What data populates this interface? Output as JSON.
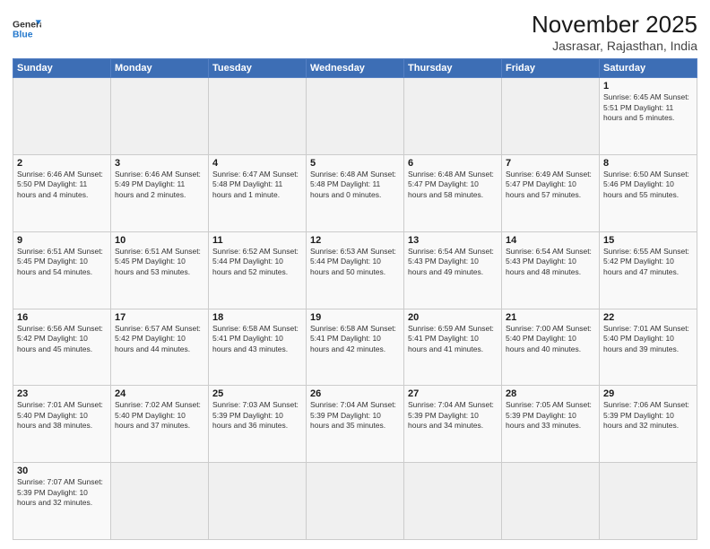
{
  "header": {
    "logo_general": "General",
    "logo_blue": "Blue",
    "title": "November 2025",
    "subtitle": "Jasrasar, Rajasthan, India"
  },
  "weekdays": [
    "Sunday",
    "Monday",
    "Tuesday",
    "Wednesday",
    "Thursday",
    "Friday",
    "Saturday"
  ],
  "weeks": [
    [
      {
        "day": "",
        "info": ""
      },
      {
        "day": "",
        "info": ""
      },
      {
        "day": "",
        "info": ""
      },
      {
        "day": "",
        "info": ""
      },
      {
        "day": "",
        "info": ""
      },
      {
        "day": "",
        "info": ""
      },
      {
        "day": "1",
        "info": "Sunrise: 6:45 AM\nSunset: 5:51 PM\nDaylight: 11 hours\nand 5 minutes."
      }
    ],
    [
      {
        "day": "2",
        "info": "Sunrise: 6:46 AM\nSunset: 5:50 PM\nDaylight: 11 hours\nand 4 minutes."
      },
      {
        "day": "3",
        "info": "Sunrise: 6:46 AM\nSunset: 5:49 PM\nDaylight: 11 hours\nand 2 minutes."
      },
      {
        "day": "4",
        "info": "Sunrise: 6:47 AM\nSunset: 5:48 PM\nDaylight: 11 hours\nand 1 minute."
      },
      {
        "day": "5",
        "info": "Sunrise: 6:48 AM\nSunset: 5:48 PM\nDaylight: 11 hours\nand 0 minutes."
      },
      {
        "day": "6",
        "info": "Sunrise: 6:48 AM\nSunset: 5:47 PM\nDaylight: 10 hours\nand 58 minutes."
      },
      {
        "day": "7",
        "info": "Sunrise: 6:49 AM\nSunset: 5:47 PM\nDaylight: 10 hours\nand 57 minutes."
      },
      {
        "day": "8",
        "info": "Sunrise: 6:50 AM\nSunset: 5:46 PM\nDaylight: 10 hours\nand 55 minutes."
      }
    ],
    [
      {
        "day": "9",
        "info": "Sunrise: 6:51 AM\nSunset: 5:45 PM\nDaylight: 10 hours\nand 54 minutes."
      },
      {
        "day": "10",
        "info": "Sunrise: 6:51 AM\nSunset: 5:45 PM\nDaylight: 10 hours\nand 53 minutes."
      },
      {
        "day": "11",
        "info": "Sunrise: 6:52 AM\nSunset: 5:44 PM\nDaylight: 10 hours\nand 52 minutes."
      },
      {
        "day": "12",
        "info": "Sunrise: 6:53 AM\nSunset: 5:44 PM\nDaylight: 10 hours\nand 50 minutes."
      },
      {
        "day": "13",
        "info": "Sunrise: 6:54 AM\nSunset: 5:43 PM\nDaylight: 10 hours\nand 49 minutes."
      },
      {
        "day": "14",
        "info": "Sunrise: 6:54 AM\nSunset: 5:43 PM\nDaylight: 10 hours\nand 48 minutes."
      },
      {
        "day": "15",
        "info": "Sunrise: 6:55 AM\nSunset: 5:42 PM\nDaylight: 10 hours\nand 47 minutes."
      }
    ],
    [
      {
        "day": "16",
        "info": "Sunrise: 6:56 AM\nSunset: 5:42 PM\nDaylight: 10 hours\nand 45 minutes."
      },
      {
        "day": "17",
        "info": "Sunrise: 6:57 AM\nSunset: 5:42 PM\nDaylight: 10 hours\nand 44 minutes."
      },
      {
        "day": "18",
        "info": "Sunrise: 6:58 AM\nSunset: 5:41 PM\nDaylight: 10 hours\nand 43 minutes."
      },
      {
        "day": "19",
        "info": "Sunrise: 6:58 AM\nSunset: 5:41 PM\nDaylight: 10 hours\nand 42 minutes."
      },
      {
        "day": "20",
        "info": "Sunrise: 6:59 AM\nSunset: 5:41 PM\nDaylight: 10 hours\nand 41 minutes."
      },
      {
        "day": "21",
        "info": "Sunrise: 7:00 AM\nSunset: 5:40 PM\nDaylight: 10 hours\nand 40 minutes."
      },
      {
        "day": "22",
        "info": "Sunrise: 7:01 AM\nSunset: 5:40 PM\nDaylight: 10 hours\nand 39 minutes."
      }
    ],
    [
      {
        "day": "23",
        "info": "Sunrise: 7:01 AM\nSunset: 5:40 PM\nDaylight: 10 hours\nand 38 minutes."
      },
      {
        "day": "24",
        "info": "Sunrise: 7:02 AM\nSunset: 5:40 PM\nDaylight: 10 hours\nand 37 minutes."
      },
      {
        "day": "25",
        "info": "Sunrise: 7:03 AM\nSunset: 5:39 PM\nDaylight: 10 hours\nand 36 minutes."
      },
      {
        "day": "26",
        "info": "Sunrise: 7:04 AM\nSunset: 5:39 PM\nDaylight: 10 hours\nand 35 minutes."
      },
      {
        "day": "27",
        "info": "Sunrise: 7:04 AM\nSunset: 5:39 PM\nDaylight: 10 hours\nand 34 minutes."
      },
      {
        "day": "28",
        "info": "Sunrise: 7:05 AM\nSunset: 5:39 PM\nDaylight: 10 hours\nand 33 minutes."
      },
      {
        "day": "29",
        "info": "Sunrise: 7:06 AM\nSunset: 5:39 PM\nDaylight: 10 hours\nand 32 minutes."
      }
    ],
    [
      {
        "day": "30",
        "info": "Sunrise: 7:07 AM\nSunset: 5:39 PM\nDaylight: 10 hours\nand 32 minutes."
      },
      {
        "day": "",
        "info": ""
      },
      {
        "day": "",
        "info": ""
      },
      {
        "day": "",
        "info": ""
      },
      {
        "day": "",
        "info": ""
      },
      {
        "day": "",
        "info": ""
      },
      {
        "day": "",
        "info": ""
      }
    ]
  ]
}
